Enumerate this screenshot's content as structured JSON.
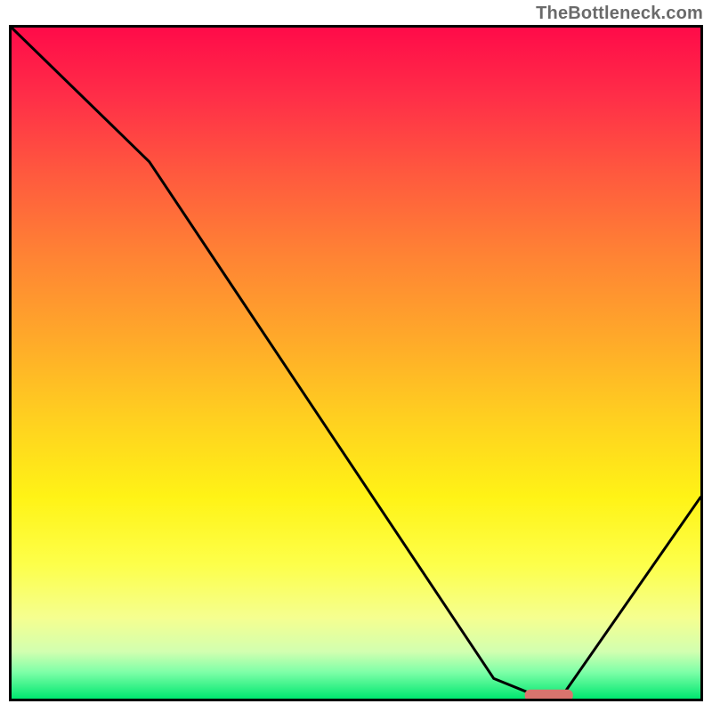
{
  "watermark": "TheBottleneck.com",
  "chart_data": {
    "type": "line",
    "title": "",
    "xlabel": "",
    "ylabel": "",
    "xlim": [
      0,
      100
    ],
    "ylim": [
      0,
      100
    ],
    "grid": false,
    "series": [
      {
        "name": "bottleneck-curve",
        "type": "line",
        "x": [
          0,
          20,
          70,
          76,
          80,
          100
        ],
        "y": [
          100,
          80,
          3,
          0.5,
          0.5,
          30
        ]
      }
    ],
    "marker": {
      "name": "optimal-range",
      "x_center": 78,
      "width": 7,
      "y": 0.5,
      "color": "#d9746e"
    },
    "gradient_palette": {
      "top": "#ff0b49",
      "mid": "#ffd21a",
      "bottom": "#00e770"
    }
  }
}
